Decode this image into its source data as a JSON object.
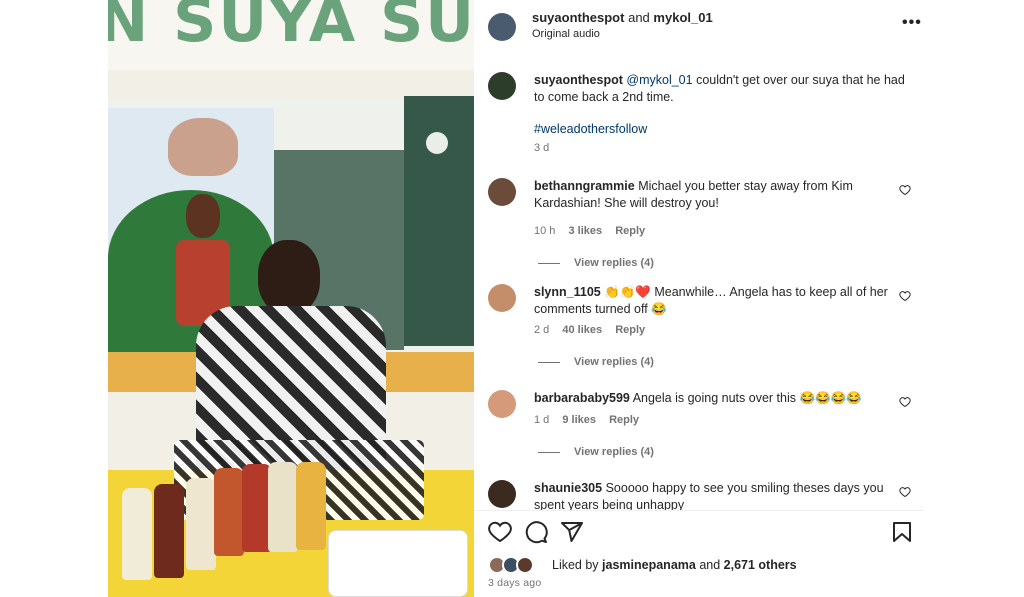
{
  "media": {
    "sign_text": "N SUYA SU"
  },
  "post": {
    "author_1": "suyaonthespot",
    "and_text": "and",
    "author_2": "mykol_01",
    "audio": "Original audio",
    "more_icon": "more-horizontal-icon"
  },
  "caption": {
    "user": "suyaonthespot",
    "mention": "@mykol_01",
    "text": "couldn't get over our suya that he had to come back a 2nd time.",
    "hashtag": "#weleadothersfollow",
    "age": "3 d"
  },
  "comments": [
    {
      "user": "bethanngrammie",
      "text": "Michael you better stay away from Kim Kardashian! She will destroy you!",
      "time": "10 h",
      "likes": "3 likes",
      "reply": "Reply",
      "view_replies": "View replies (4)",
      "avatar_color": "#6b4b3a"
    },
    {
      "user": "slynn_1105",
      "text": "👏👏❤️ Meanwhile… Angela has to keep all of her comments turned off 😂",
      "time": "2 d",
      "likes": "40 likes",
      "reply": "Reply",
      "view_replies": "View replies (4)",
      "avatar_color": "#c58e6a"
    },
    {
      "user": "barbarababy599",
      "text": "Angela is going nuts over this 😂😂😂😂",
      "time": "1 d",
      "likes": "9 likes",
      "reply": "Reply",
      "view_replies": "View replies (4)",
      "avatar_color": "#d49a7a"
    },
    {
      "user": "shaunie305",
      "text": "Sooooo happy to see you smiling theses days you spent years being unhappy",
      "avatar_color": "#3a2a20"
    }
  ],
  "actions": {
    "like_icon": "heart-icon",
    "comment_icon": "comment-icon",
    "share_icon": "share-icon",
    "save_icon": "bookmark-icon"
  },
  "likes": {
    "prefix": "Liked by",
    "user": "jasminepanama",
    "and": "and",
    "others": "2,671 others"
  },
  "date": "3 days ago",
  "colors": {
    "link": "#00376b",
    "muted": "#737373",
    "text": "#262626"
  }
}
